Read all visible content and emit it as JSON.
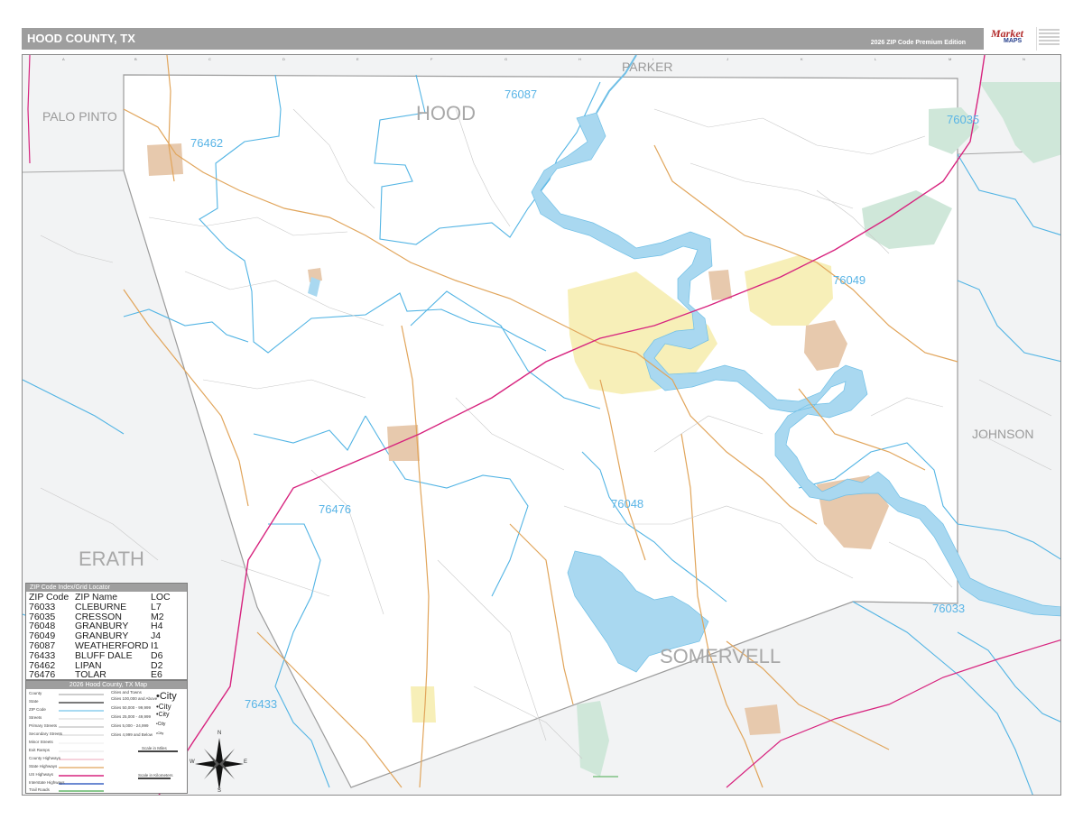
{
  "header": {
    "title": "HOOD COUNTY, TX",
    "edition": "2026 ZIP Code Premium Edition"
  },
  "logo": {
    "brand": "Market",
    "sub": "MAPS"
  },
  "counties": {
    "hood": "HOOD",
    "parker": "PARKER",
    "palo_pinto": "PALO PINTO",
    "erath": "ERATH",
    "johnson": "JOHNSON",
    "somervell": "SOMERVELL"
  },
  "zips": {
    "z76087": "76087",
    "z76462": "76462",
    "z76035": "76035",
    "z76049": "76049",
    "z76048": "76048",
    "z76476": "76476",
    "z76033": "76033",
    "z76433": "76433"
  },
  "zip_index": {
    "title": "ZIP Code Index/Grid Locator",
    "headers": [
      "ZIP Code",
      "ZIP Name",
      "LOC"
    ],
    "rows": [
      [
        "76033",
        "CLEBURNE",
        "L7"
      ],
      [
        "76035",
        "CRESSON",
        "M2"
      ],
      [
        "76048",
        "GRANBURY",
        "H4"
      ],
      [
        "76049",
        "GRANBURY",
        "J4"
      ],
      [
        "76087",
        "WEATHERFORD",
        "I1"
      ],
      [
        "76433",
        "BLUFF DALE",
        "D6"
      ],
      [
        "76462",
        "LIPAN",
        "D2"
      ],
      [
        "76476",
        "TOLAR",
        "E6"
      ]
    ]
  },
  "legend": {
    "title": "2026 Hood County, TX Map",
    "items": [
      "County",
      "State",
      "ZIP Code",
      "Streets",
      "Primary Streets",
      "Secondary Streets",
      "Minor Streets",
      "Exit Ramps",
      "County Highways",
      "State Highways",
      "US Highways",
      "Interstate Highways",
      "Trail Roads"
    ],
    "city_header": "Cities and Towns",
    "city_classes": [
      "Cities 100,000 and Above",
      "Cities 50,000 - 99,999",
      "Cities 25,000 - 49,999",
      "Cities 5,000 - 24,999",
      "Cities 4,999 and Below"
    ],
    "city_symbols": [
      "•City",
      "•City",
      "•City",
      "•City",
      "•City"
    ],
    "scale_miles": "Scale in Miles",
    "scale_km": "Scale in Kilometers"
  },
  "compass": {
    "n": "N",
    "s": "S",
    "e": "E",
    "w": "W"
  },
  "grid_columns": [
    "A",
    "B",
    "C",
    "D",
    "E",
    "F",
    "G",
    "H",
    "I",
    "J",
    "K",
    "L",
    "M",
    "N"
  ],
  "colors": {
    "title_bar": "#9e9e9e",
    "water": "#a9d8f0",
    "water_stroke": "#6fbfe6",
    "zip_boundary": "#52b4e4",
    "county_outside": "#f2f3f4",
    "city_fill": "#f7efb8",
    "town_fill": "#e7c9ad",
    "park_fill": "#cfe7d9",
    "interstate": "#d7237e",
    "highway": "#e1a55b"
  }
}
